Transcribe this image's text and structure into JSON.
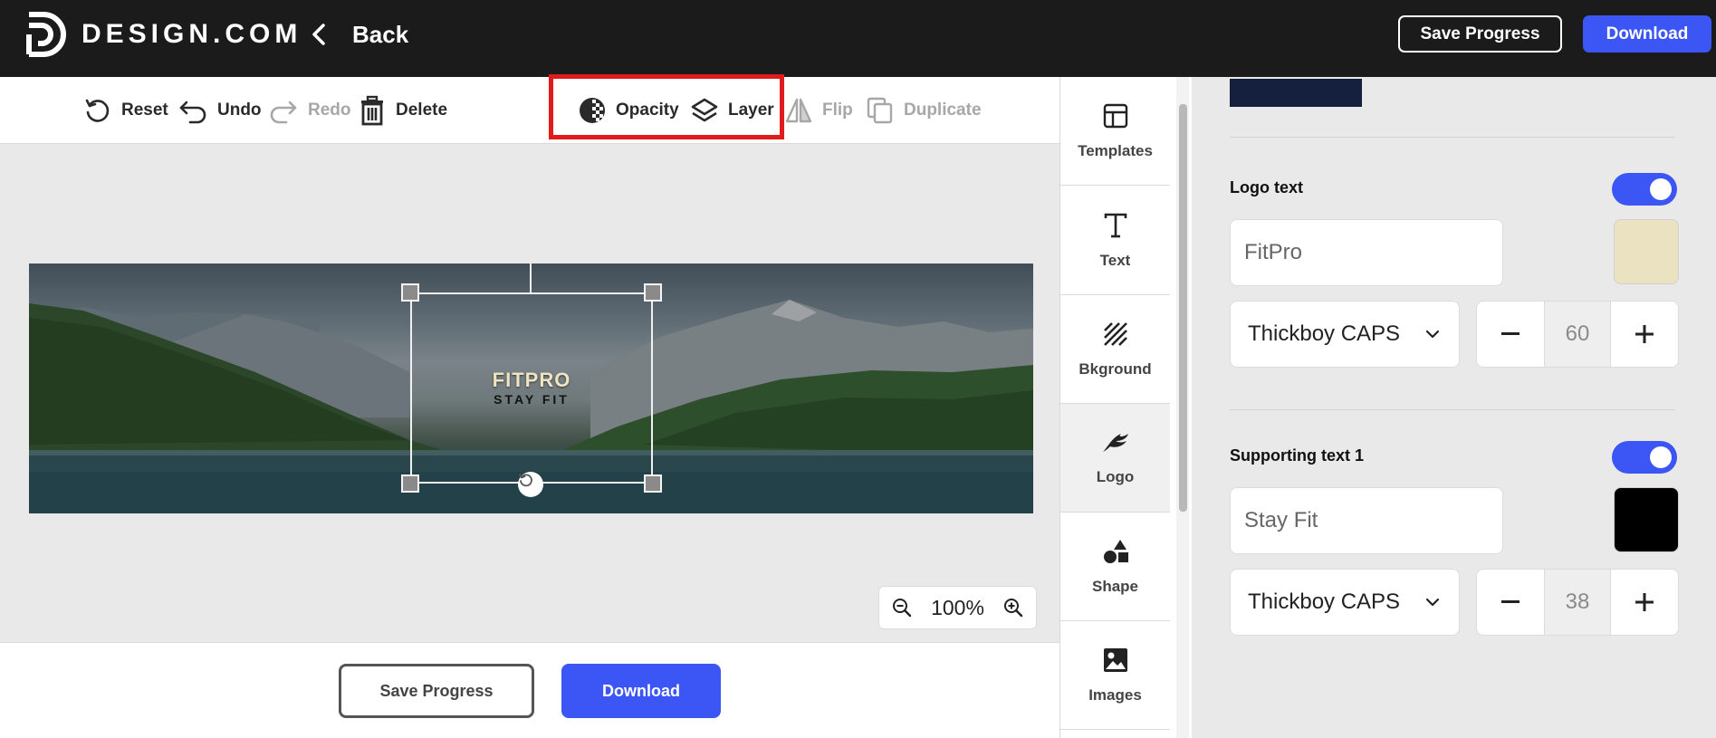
{
  "header": {
    "brand": "DESIGN.COM",
    "back_label": "Back",
    "save_progress": "Save Progress",
    "download": "Download"
  },
  "toolbar": {
    "reset": "Reset",
    "undo": "Undo",
    "redo": "Redo",
    "delete": "Delete",
    "opacity": "Opacity",
    "layer": "Layer",
    "flip": "Flip",
    "duplicate": "Duplicate"
  },
  "canvas": {
    "logo_title": "FITPRO",
    "logo_subtitle": "STAY FIT",
    "zoom": "100%"
  },
  "bottom": {
    "save_progress": "Save Progress",
    "download": "Download"
  },
  "sidebar": {
    "items": [
      {
        "label": "Templates",
        "icon": "templates-icon"
      },
      {
        "label": "Text",
        "icon": "text-icon"
      },
      {
        "label": "Bkground",
        "icon": "background-icon"
      },
      {
        "label": "Logo",
        "icon": "logo-icon"
      },
      {
        "label": "Shape",
        "icon": "shape-icon"
      },
      {
        "label": "Images",
        "icon": "images-icon"
      }
    ]
  },
  "panel": {
    "logo_text": {
      "label": "Logo text",
      "enabled": true,
      "value": "FitPro",
      "color": "#ebe2c2",
      "font": "Thickboy CAPS",
      "size": "60"
    },
    "supporting_text_1": {
      "label": "Supporting text 1",
      "enabled": true,
      "value": "Stay Fit",
      "color": "#000000",
      "font": "Thickboy CAPS",
      "size": "38"
    }
  },
  "colors": {
    "accent": "#3b56f5",
    "header_bg": "#1b1b1b",
    "highlight": "#e01b1b",
    "top_swatch": "#15203e"
  }
}
